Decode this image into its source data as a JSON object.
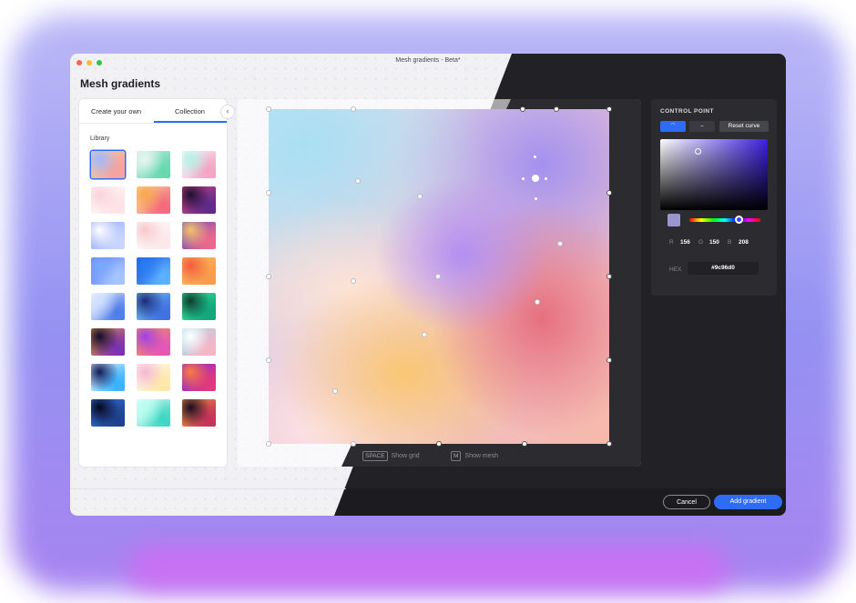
{
  "window": {
    "title": "Mesh gradients - Beta*"
  },
  "app": {
    "heading": "Mesh gradients"
  },
  "traffic_lights": {
    "close": "#ff5f57",
    "minimize": "#febc2e",
    "zoom": "#28c840"
  },
  "tabs": [
    {
      "label": "Create your own",
      "active": false
    },
    {
      "label": "Collection",
      "active": true
    }
  ],
  "collapse_icon": "chevron-left-icon",
  "library": {
    "label": "Library",
    "thumbnails": [
      {
        "colors": [
          "#9fb6ff",
          "#f6a0a0",
          "#f8d49a"
        ],
        "selected": true
      },
      {
        "colors": [
          "#e9f5f2",
          "#66d8b0",
          "#c7efe2"
        ]
      },
      {
        "colors": [
          "#b4f0e6",
          "#f3a3c2",
          "#ffffff"
        ]
      },
      {
        "colors": [
          "#f9d2d9",
          "#fde2e6",
          "#ffffff"
        ]
      },
      {
        "colors": [
          "#f7a64b",
          "#f4677e",
          "#fbe3a6"
        ]
      },
      {
        "colors": [
          "#1b0f33",
          "#5d2a8a",
          "#e64a8a"
        ]
      },
      {
        "colors": [
          "#ffffff",
          "#cbd7ff",
          "#8ea4f3"
        ]
      },
      {
        "colors": [
          "#f8c9cc",
          "#fbe7ea",
          "#ffffff"
        ]
      },
      {
        "colors": [
          "#f9c26a",
          "#ee6a8a",
          "#5a48c7"
        ]
      },
      {
        "colors": [
          "#7aa9ff",
          "#a8c7ff",
          "#5a7df6"
        ]
      },
      {
        "colors": [
          "#2a7df4",
          "#5cb5ff",
          "#1a55d9"
        ]
      },
      {
        "colors": [
          "#f35a3c",
          "#f99a4b",
          "#fbc260"
        ]
      },
      {
        "colors": [
          "#cfe0ff",
          "#4b7ae8",
          "#ffffff"
        ]
      },
      {
        "colors": [
          "#1b2a7a",
          "#3e6fe0",
          "#7ad0f9"
        ]
      },
      {
        "colors": [
          "#0e3b2f",
          "#12a37a",
          "#3af3a2"
        ]
      },
      {
        "colors": [
          "#120a2e",
          "#7a2fb0",
          "#f0a040"
        ]
      },
      {
        "colors": [
          "#a33ee6",
          "#e255b8",
          "#f6a04b"
        ]
      },
      {
        "colors": [
          "#ffffff",
          "#f7b4c6",
          "#a0dceb"
        ]
      },
      {
        "colors": [
          "#0b1a5a",
          "#36b0ff",
          "#ffffff"
        ]
      },
      {
        "colors": [
          "#f5b7d2",
          "#ffe7a6",
          "#ffffff"
        ]
      },
      {
        "colors": [
          "#ff7a3c",
          "#e23a7a",
          "#7a2ae0"
        ]
      },
      {
        "colors": [
          "#04061a",
          "#1f3f8a",
          "#3a7af0"
        ]
      },
      {
        "colors": [
          "#b4fff0",
          "#3ad6c2",
          "#ffffff"
        ]
      },
      {
        "colors": [
          "#1a0a22",
          "#c2305a",
          "#f6a640"
        ]
      }
    ]
  },
  "hints": [
    {
      "key": "SPACE",
      "label": "Show grid"
    },
    {
      "key": "M",
      "label": "Show mesh"
    }
  ],
  "control_point": {
    "title": "CONTROL POINT",
    "mode_icons": [
      "bezier-mode-icon",
      "smooth-mode-icon"
    ],
    "reset_label": "Reset curve",
    "swatch_color": "#9c96d0",
    "rgb": [
      {
        "label": "R",
        "value": "156"
      },
      {
        "label": "G",
        "value": "150"
      },
      {
        "label": "B",
        "value": "208"
      }
    ],
    "hex_label": "HEX",
    "hex_value": "#9c96d0"
  },
  "footer": {
    "cancel_label": "Cancel",
    "add_label": "Add gradient"
  },
  "accent": "#2f6cf6"
}
